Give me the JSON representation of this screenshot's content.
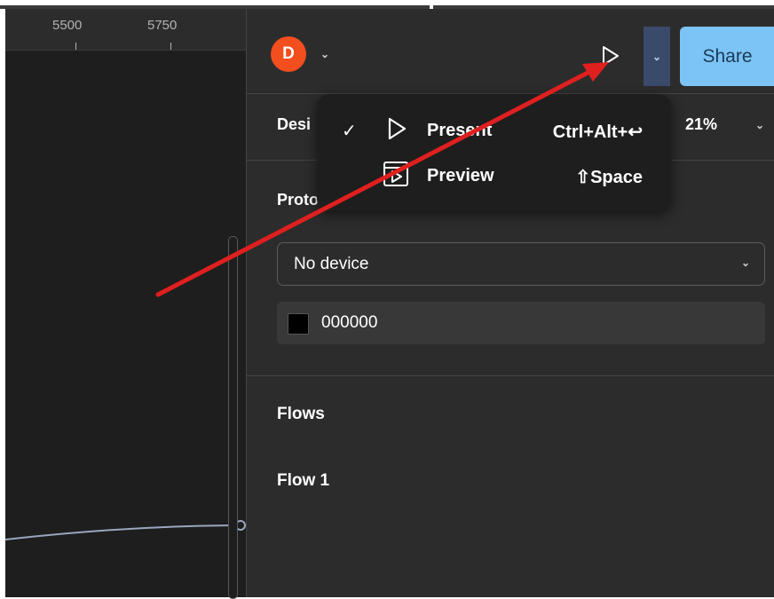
{
  "ruler": {
    "labels": [
      "5500",
      "5750"
    ]
  },
  "header": {
    "avatar_initial": "D",
    "share_label": "Share",
    "present_icon": "play-icon"
  },
  "tabs": {
    "design_label_partial": "Desi",
    "zoom": "21%"
  },
  "present_menu": {
    "items": [
      {
        "label": "Present",
        "shortcut": "Ctrl+Alt+↩",
        "checked": true,
        "icon": "play-icon"
      },
      {
        "label": "Preview",
        "shortcut": "⇧Space",
        "checked": false,
        "icon": "preview-icon"
      }
    ],
    "check_glyph": "✓"
  },
  "prototype": {
    "title_partial": "Proto",
    "device_value": "No device",
    "background_color": "000000"
  },
  "flows": {
    "title": "Flows",
    "items": [
      "Flow 1"
    ]
  },
  "colors": {
    "accent_share": "#7cc4f5",
    "annotation_arrow": "#e01f1f",
    "avatar": "#f24e1e"
  }
}
